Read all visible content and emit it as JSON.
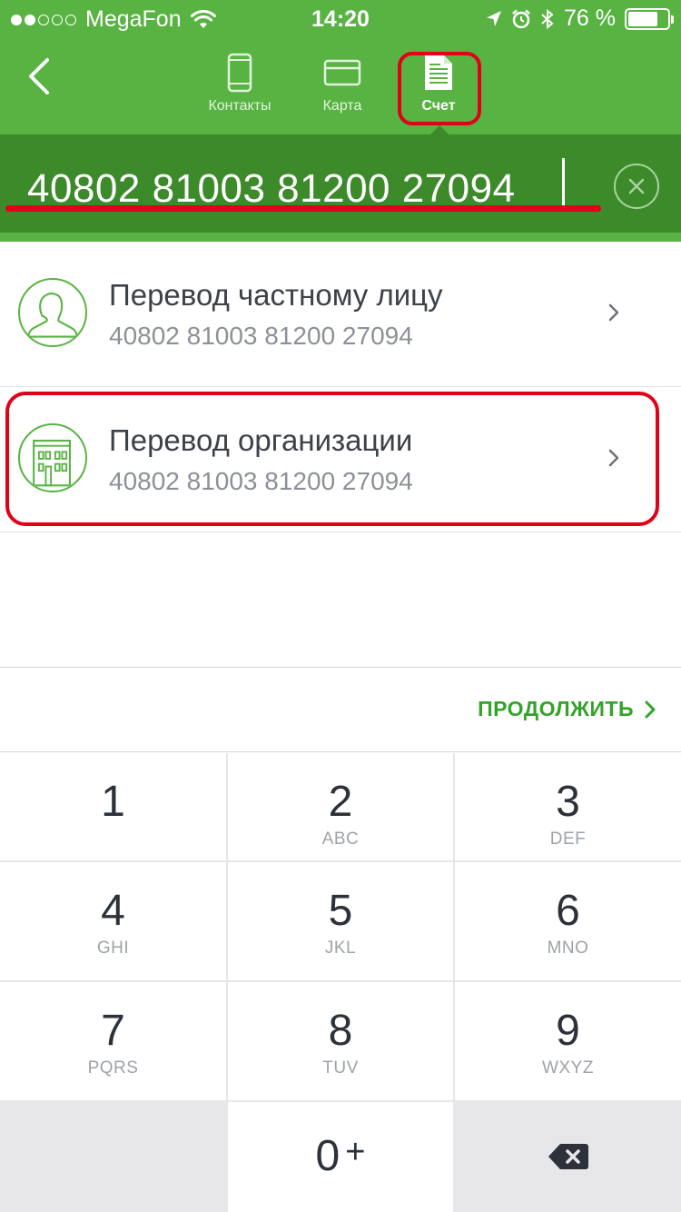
{
  "status_bar": {
    "carrier": "MegaFon",
    "time": "14:20",
    "battery": "76 %",
    "battery_level": 0.76
  },
  "tabs": [
    {
      "label": "Контакты",
      "icon": "phone-icon",
      "active": false
    },
    {
      "label": "Карта",
      "icon": "card-icon",
      "active": false
    },
    {
      "label": "Счет",
      "icon": "document-icon",
      "active": true
    }
  ],
  "account_input": {
    "value": "40802 81003 81200 27094"
  },
  "results": [
    {
      "title": "Перевод частному лицу",
      "subtitle": "40802 81003 81200 27094",
      "icon": "person-icon"
    },
    {
      "title": "Перевод организации",
      "subtitle": "40802 81003 81200 27094",
      "icon": "building-icon"
    }
  ],
  "continue": {
    "label": "ПРОДОЛЖИТЬ"
  },
  "keypad": {
    "keys": [
      {
        "digit": "1",
        "letters": ""
      },
      {
        "digit": "2",
        "letters": "ABC"
      },
      {
        "digit": "3",
        "letters": "DEF"
      },
      {
        "digit": "4",
        "letters": "GHI"
      },
      {
        "digit": "5",
        "letters": "JKL"
      },
      {
        "digit": "6",
        "letters": "MNO"
      },
      {
        "digit": "7",
        "letters": "PQRS"
      },
      {
        "digit": "8",
        "letters": "TUV"
      },
      {
        "digit": "9",
        "letters": "WXYZ"
      }
    ],
    "zero": "0",
    "plus": "+"
  },
  "colors": {
    "brand_green": "#58b343",
    "dark_green": "#3d8a2b",
    "accent_green": "#34a32a",
    "annotation_red": "#e1001a"
  }
}
